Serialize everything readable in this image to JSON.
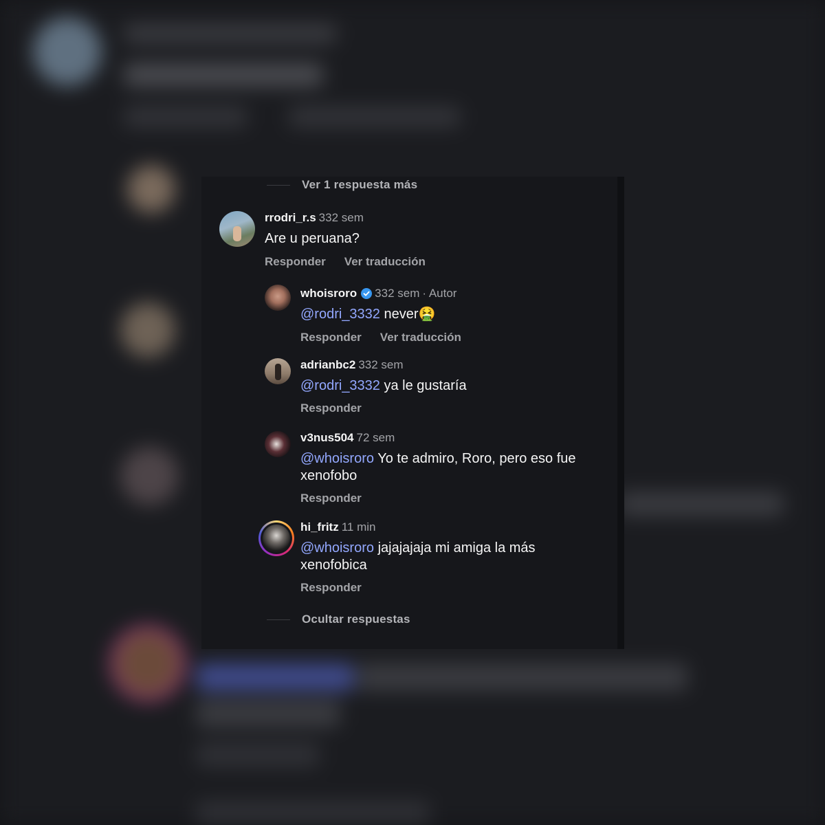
{
  "thread": {
    "view_more_label": "Ver 1 respuesta más",
    "hide_replies_label": "Ocultar respuestas"
  },
  "comments": [
    {
      "username": "rrodri_r.s",
      "time": "332 sem",
      "text": "Are u peruana?",
      "reply_label": "Responder",
      "translate_label": "Ver traducción"
    },
    {
      "username": "whoisroro",
      "verified": true,
      "time": "332 sem",
      "author_tag": "· Autor",
      "mention": "@rodri_3332",
      "text": " never",
      "emoji": "🤮",
      "reply_label": "Responder",
      "translate_label": "Ver traducción"
    },
    {
      "username": "adrianbc2",
      "time": "332 sem",
      "mention": "@rodri_3332",
      "text": " ya le gustaría",
      "reply_label": "Responder"
    },
    {
      "username": "v3nus504",
      "time": "72 sem",
      "mention": "@whoisroro",
      "text": " Yo te admiro, Roro, pero eso fue",
      "text2": "xenofobo",
      "reply_label": "Responder"
    },
    {
      "username": "hi_fritz",
      "time": "11 min",
      "mention": "@whoisroro",
      "text": " jajajajaja mi amiga la más",
      "text2": "xenofobica",
      "reply_label": "Responder"
    }
  ],
  "colors": {
    "background": "#16171b",
    "mention": "#93a8ff",
    "secondary_text": "#a3a4a8",
    "verified": "#3897f0"
  }
}
